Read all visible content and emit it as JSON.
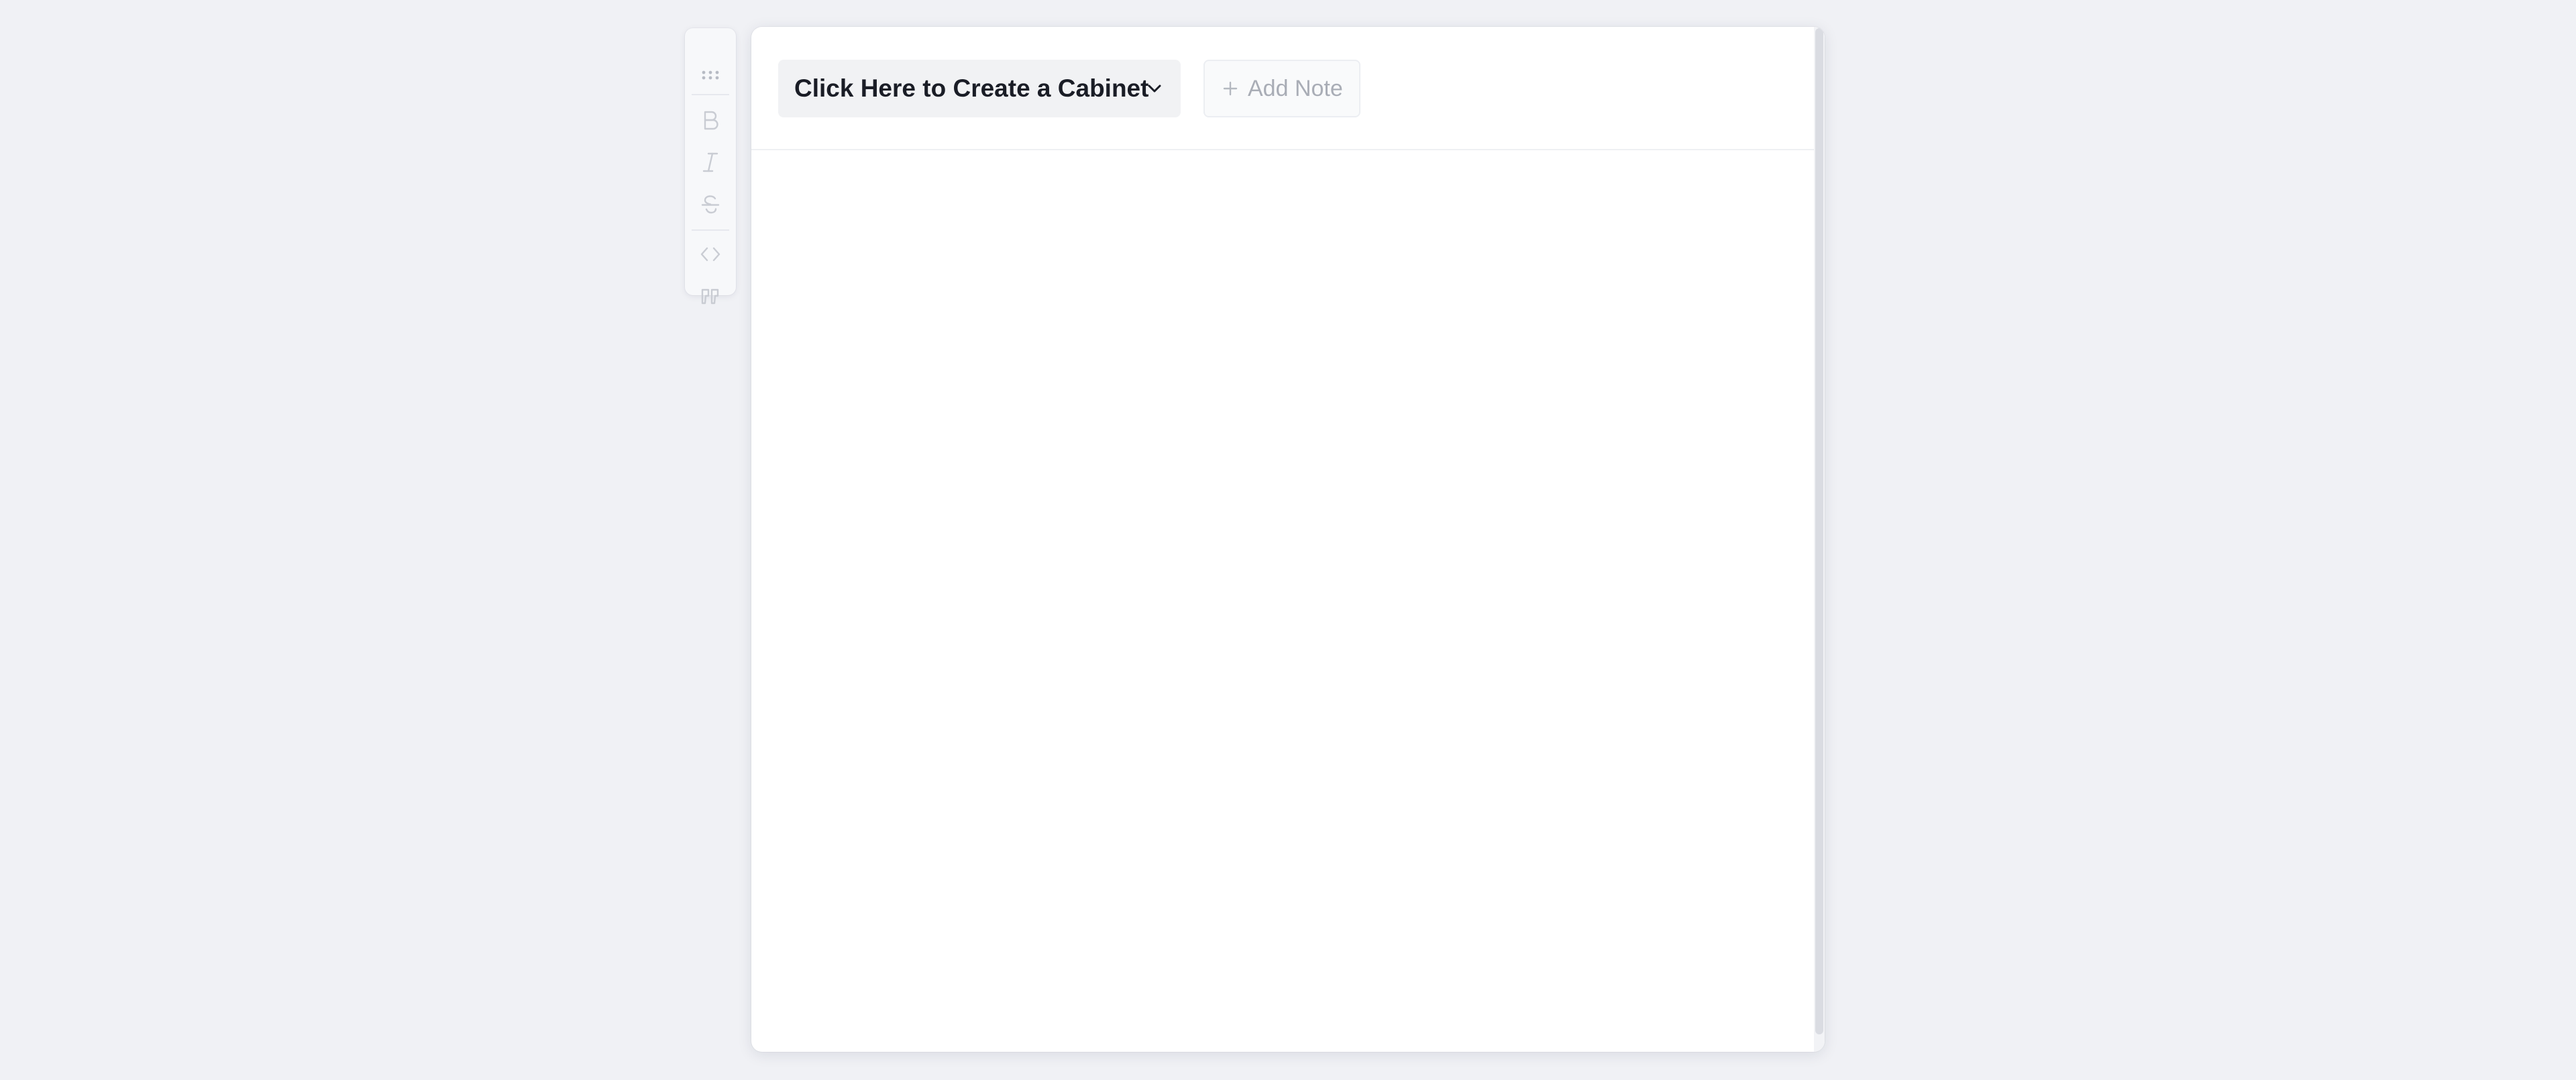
{
  "toolbar": {
    "buttons": [
      {
        "name": "drag-handle-icon",
        "icon": "grip-dots"
      },
      {
        "name": "bold-icon",
        "icon": "bold"
      },
      {
        "name": "italic-icon",
        "icon": "italic"
      },
      {
        "name": "strikethrough-icon",
        "icon": "strikethrough"
      },
      {
        "name": "code-icon",
        "icon": "code"
      },
      {
        "name": "quote-icon",
        "icon": "quote"
      }
    ]
  },
  "header": {
    "cabinet_select_label": "Click Here to Create a Cabinet",
    "add_note_label": "Add Note"
  },
  "colors": {
    "page_background": "#f0f1f5",
    "panel_background": "#ffffff",
    "select_background": "#f1f2f4",
    "label_text": "#1a1d26",
    "disabled_text": "#a9adb6",
    "toolbar_icon": "#c5c8cf"
  }
}
